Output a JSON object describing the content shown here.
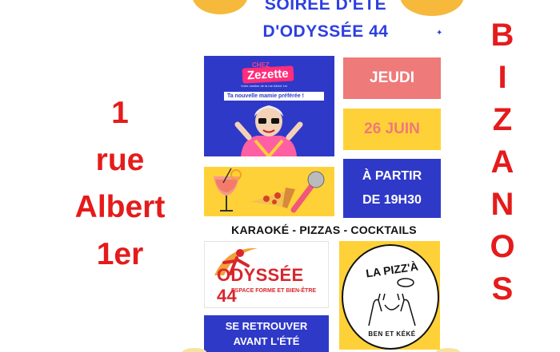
{
  "title": {
    "line1": "SOIRÉE D'ÉTÉ",
    "line2": "D'ODYSSÉE 44"
  },
  "address": [
    "1",
    "rue",
    "Albert",
    "1er"
  ],
  "city_letters": [
    "B",
    "I",
    "Z",
    "A",
    "N",
    "O",
    "S"
  ],
  "zezette": {
    "chez": "CHEZ",
    "brand": "Zezette",
    "small_text": "Votre cantine de la rue Albert 1er",
    "tagline": "Ta nouvelle mamie préférée !"
  },
  "event": {
    "day": "JEUDI",
    "date": "26 JUIN",
    "time_line1": "À PARTIR",
    "time_line2": "DE 19H30"
  },
  "activities": "KARAOKÉ - PIZZAS - COCKTAILS",
  "odyssee": {
    "logo": "ODYSSÉE 44",
    "subtitle": "ESPACE FORME ET BIEN-ÊTRE"
  },
  "pizza": {
    "name": "LA PIZZ'À",
    "subtitle": "BEN ET KÉKÉ"
  },
  "cta": {
    "line1": "SE RETROUVER",
    "line2": "AVANT L'ÉTÉ"
  },
  "colors": {
    "blue": "#2f39c8",
    "red": "#e51b1b",
    "yellow": "#ffd138",
    "pink": "#ee7a79"
  }
}
